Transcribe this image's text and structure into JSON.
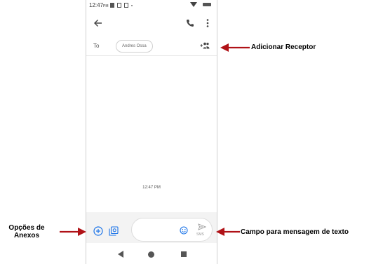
{
  "status_bar": {
    "time": "12:47",
    "ampm": "PM"
  },
  "recipient": {
    "to_label": "To",
    "chip_name": "Andres Ossa"
  },
  "conversation": {
    "timestamp": "12:47 PM"
  },
  "compose": {
    "placeholder": "",
    "send_label": "SMS"
  },
  "annotations": {
    "add_receiver": "Adicionar Receptor",
    "attachment_options_line1": "Opções de",
    "attachment_options_line2": "Anexos",
    "text_field": "Campo para mensagem de texto"
  },
  "colors": {
    "arrow": "#b01217",
    "icon": "#444444",
    "attach_blue": "#1a73e8"
  },
  "icons": [
    "back-arrow-icon",
    "phone-icon",
    "more-vert-icon",
    "add-person-icon",
    "add-circle-icon",
    "gallery-icon",
    "emoji-icon",
    "send-icon"
  ]
}
